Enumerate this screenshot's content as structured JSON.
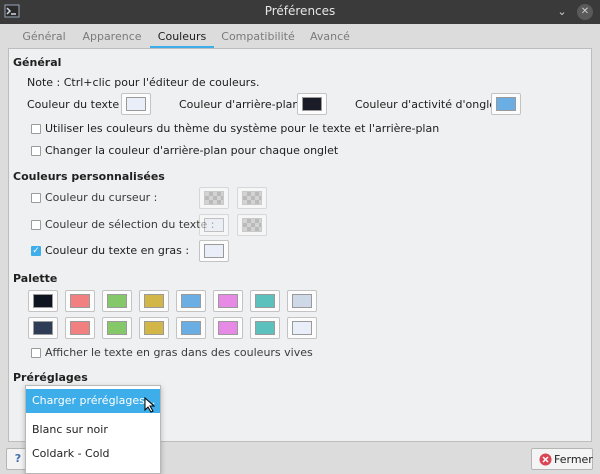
{
  "window": {
    "title": "Préférences"
  },
  "tabs": [
    "Général",
    "Apparence",
    "Couleurs",
    "Compatibilité",
    "Avancé"
  ],
  "general": {
    "heading": "Général",
    "note": "Note : Ctrl+clic pour l'éditeur de couleurs.",
    "text_color_label": "Couleur du texte :",
    "bg_color_label": "Couleur d'arrière-plan :",
    "tab_activity_label": "Couleur d'activité d'onglet :",
    "text_color": "#e9eef8",
    "bg_color": "#1a1d28",
    "tab_activity_color": "#6aaee4",
    "use_system_colors_label": "Utiliser les couleurs du thème du système pour le texte et l'arrière-plan",
    "change_bg_label": "Changer la couleur d'arrière-plan pour chaque onglet"
  },
  "custom": {
    "heading": "Couleurs personnalisées",
    "cursor_label": "Couleur du curseur :",
    "selection_label": "Couleur de sélection du texte :",
    "bold_label": "Couleur du texte en gras :",
    "selection_color": "#e9eef8",
    "bold_color": "#e9eef8"
  },
  "palette": {
    "heading": "Palette",
    "row1": [
      "#0f1520",
      "#f28080",
      "#85c86a",
      "#d2b647",
      "#6aaee4",
      "#e78ae6",
      "#5cc0bd",
      "#cfd8e6"
    ],
    "row2": [
      "#2e3c55",
      "#f28080",
      "#85c86a",
      "#d2b647",
      "#6aaee4",
      "#e78ae6",
      "#5cc0bd",
      "#e9eef8"
    ],
    "bright_bold_label": "Afficher le texte en gras dans des couleurs vives"
  },
  "presets": {
    "heading": "Préréglages",
    "items": [
      "Charger préréglages...",
      "Blanc sur noir",
      "Coldark - Cold"
    ]
  },
  "footer": {
    "close_label": "Fermer",
    "help_label": "?"
  }
}
